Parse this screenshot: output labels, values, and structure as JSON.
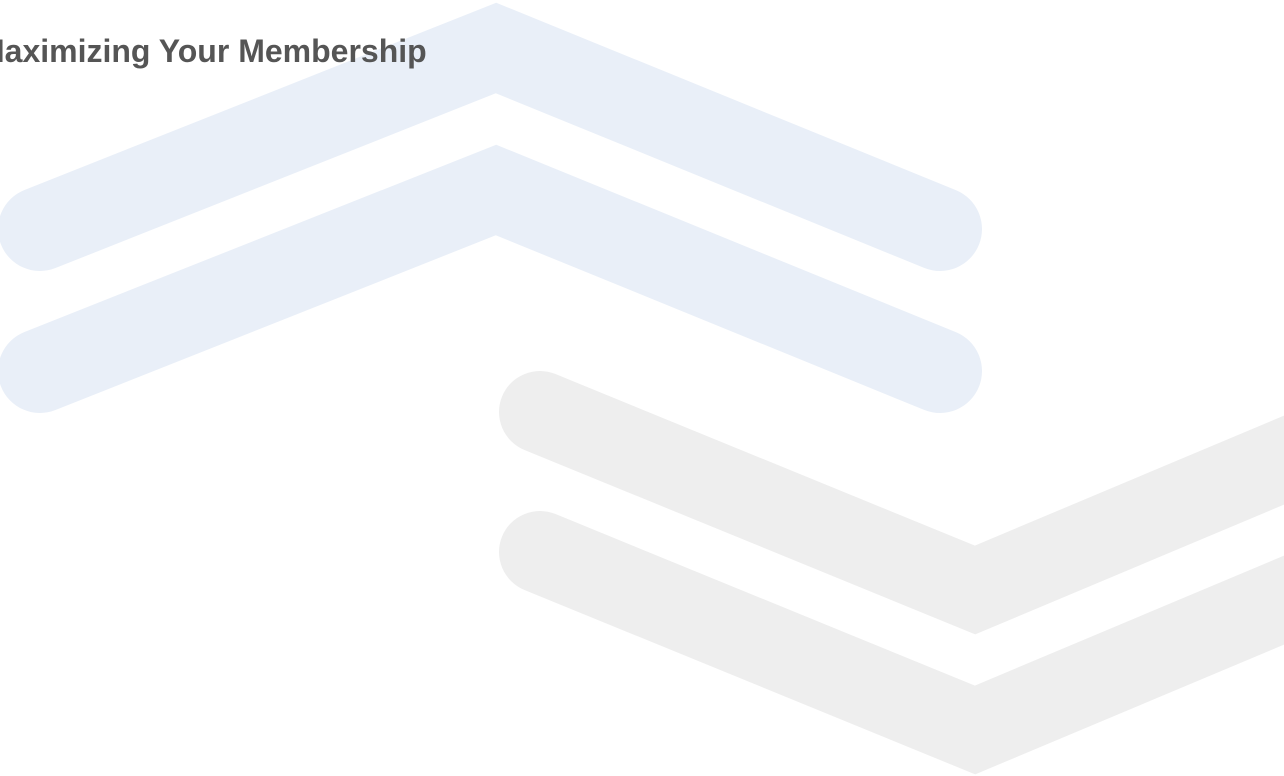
{
  "slide": {
    "title": "Maximizing Your Membership"
  },
  "graphic": {
    "chevron_color_upper": "#e9eff8",
    "chevron_color_lower": "#eeeeee"
  }
}
